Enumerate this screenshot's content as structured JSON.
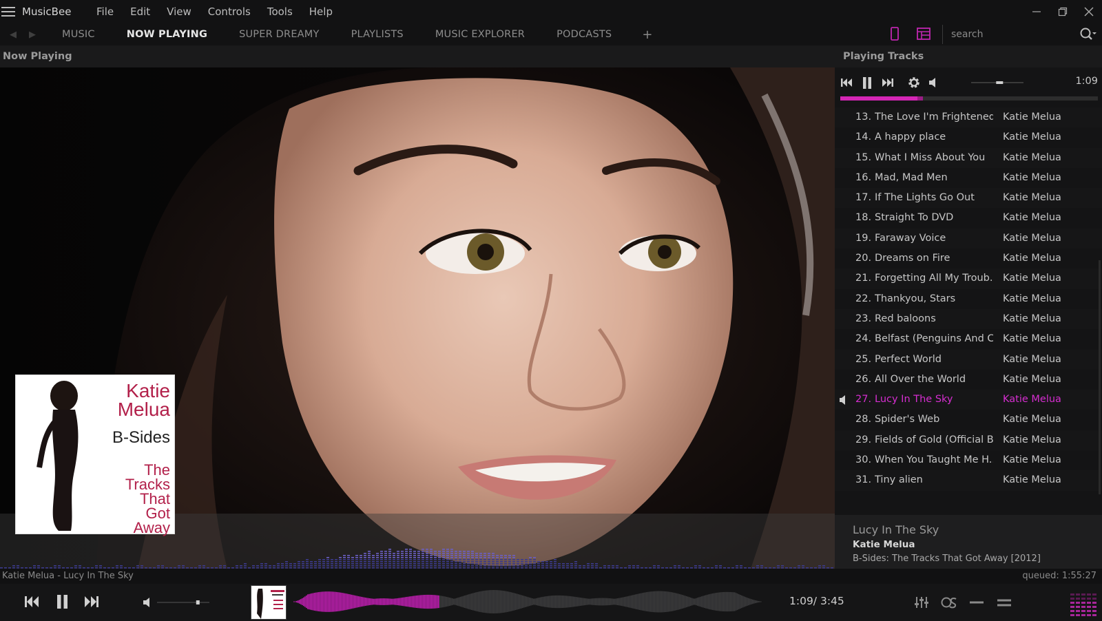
{
  "app": {
    "title": "MusicBee"
  },
  "menu": [
    "File",
    "Edit",
    "View",
    "Controls",
    "Tools",
    "Help"
  ],
  "tabs": [
    {
      "label": "MUSIC",
      "active": false
    },
    {
      "label": "NOW PLAYING",
      "active": true
    },
    {
      "label": "SUPER DREAMY",
      "active": false
    },
    {
      "label": "PLAYLISTS",
      "active": false
    },
    {
      "label": "MUSIC EXPLORER",
      "active": false
    },
    {
      "label": "PODCASTS",
      "active": false
    }
  ],
  "tab_add": "+",
  "search": {
    "placeholder": "search"
  },
  "now_playing_panel": {
    "header": "Now Playing"
  },
  "album_cover": {
    "artist": "Katie Melua",
    "title": "B-Sides",
    "subtitle": "The Tracks That Got Away"
  },
  "playing_tracks": {
    "header": "Playing Tracks",
    "time": "1:09",
    "progress": 0.32,
    "volume": 0.55,
    "tracks": [
      {
        "num": "13.",
        "title": "The Love I'm Frightened...",
        "artist": "Katie Melua",
        "playing": false
      },
      {
        "num": "14.",
        "title": "A happy place",
        "artist": "Katie Melua",
        "playing": false
      },
      {
        "num": "15.",
        "title": "What I Miss About You",
        "artist": "Katie Melua",
        "playing": false
      },
      {
        "num": "16.",
        "title": "Mad, Mad Men",
        "artist": "Katie Melua",
        "playing": false
      },
      {
        "num": "17.",
        "title": "If The Lights Go Out",
        "artist": "Katie Melua",
        "playing": false
      },
      {
        "num": "18.",
        "title": "Straight To DVD",
        "artist": "Katie Melua",
        "playing": false
      },
      {
        "num": "19.",
        "title": "Faraway Voice",
        "artist": "Katie Melua",
        "playing": false
      },
      {
        "num": "20.",
        "title": "Dreams on Fire",
        "artist": "Katie Melua",
        "playing": false
      },
      {
        "num": "21.",
        "title": "Forgetting All My Troub...",
        "artist": "Katie Melua",
        "playing": false
      },
      {
        "num": "22.",
        "title": "Thankyou, Stars",
        "artist": "Katie Melua",
        "playing": false
      },
      {
        "num": "23.",
        "title": "Red baloons",
        "artist": "Katie Melua",
        "playing": false
      },
      {
        "num": "24.",
        "title": "Belfast (Penguins And C...",
        "artist": "Katie Melua",
        "playing": false
      },
      {
        "num": "25.",
        "title": "Perfect World",
        "artist": "Katie Melua",
        "playing": false
      },
      {
        "num": "26.",
        "title": "All Over the World",
        "artist": "Katie Melua",
        "playing": false
      },
      {
        "num": "27.",
        "title": "Lucy In The Sky",
        "artist": "Katie Melua",
        "playing": true
      },
      {
        "num": "28.",
        "title": "Spider's Web",
        "artist": "Katie Melua",
        "playing": false
      },
      {
        "num": "29.",
        "title": "Fields of Gold (Official B...",
        "artist": "Katie Melua",
        "playing": false
      },
      {
        "num": "30.",
        "title": "When You Taught Me H...",
        "artist": "Katie Melua",
        "playing": false
      },
      {
        "num": "31.",
        "title": "Tiny alien",
        "artist": "Katie Melua",
        "playing": false
      }
    ]
  },
  "current_song": {
    "title": "Lucy In The Sky",
    "artist": "Katie Melua",
    "album": "B-Sides: The Tracks That Got Away [2012]"
  },
  "status": {
    "left": "Katie Melua - Lucy In The Sky",
    "right": "queued: 1:55:27"
  },
  "player": {
    "time": "1:09/ 3:45",
    "progress": 0.31,
    "volume": 0.8
  },
  "colors": {
    "accent": "#d426b5",
    "playing_text": "#d62ed0",
    "background": "#121213"
  }
}
